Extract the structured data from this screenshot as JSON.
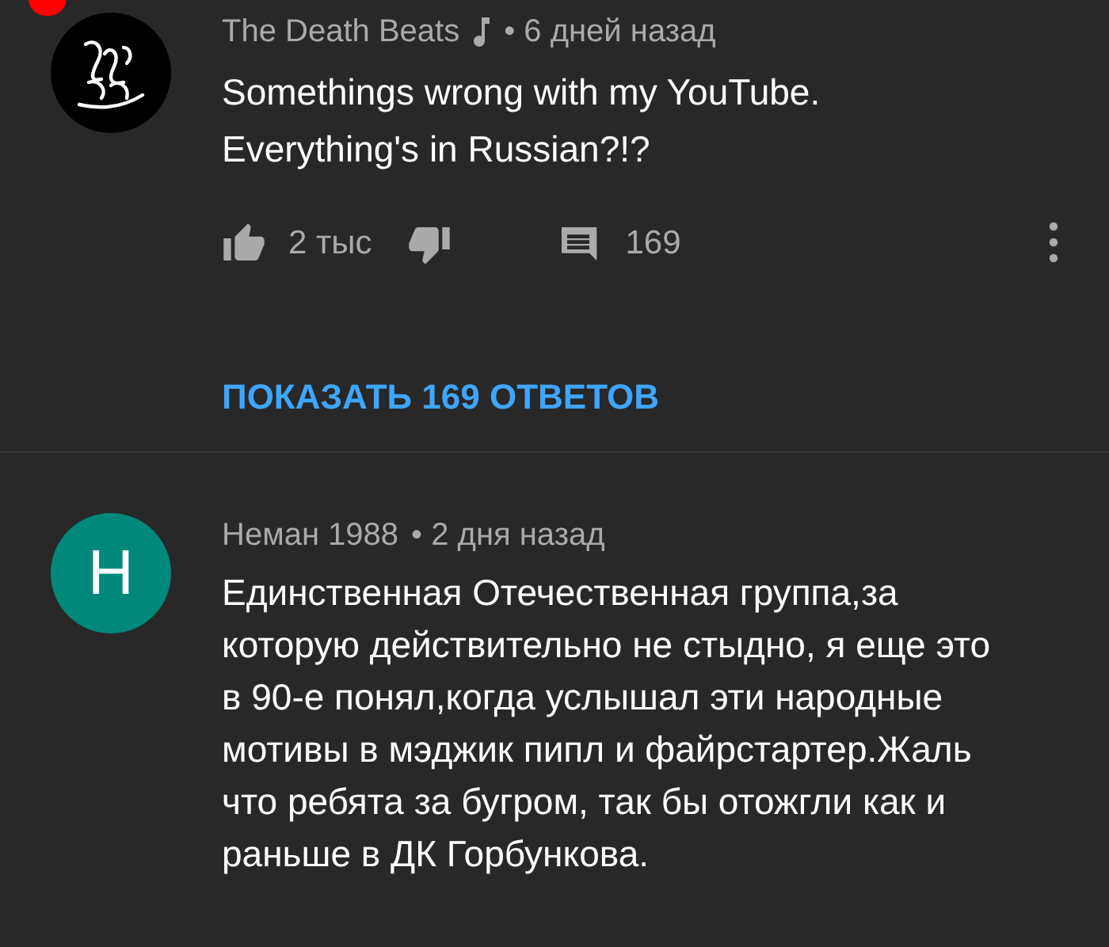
{
  "comments": [
    {
      "avatar": {
        "kind": "logo"
      },
      "author": "The Death Beats",
      "artist_badge": true,
      "time": "• 6 дней назад",
      "text": "Somethings wrong with my YouTube. Everything's in Russian?!?",
      "likes": "2 тыс",
      "replies": "169",
      "show_replies": "ПОКАЗАТЬ 169 ОТВЕТОВ",
      "notification_dot": true
    },
    {
      "avatar": {
        "kind": "letter",
        "letter": "Н",
        "color": "#00897b"
      },
      "author": "Неман 1988",
      "artist_badge": false,
      "time": "• 2 дня назад",
      "text": "Единственная Отечественная группа,за которую действительно не стыдно, я еще это в 90-е понял,когда услышал эти народные мотивы в мэджик пипл и файрстартер.Жаль что ребята за бугром, так бы отожгли как и раньше в ДК Горбункова.",
      "notification_dot": false
    }
  ]
}
